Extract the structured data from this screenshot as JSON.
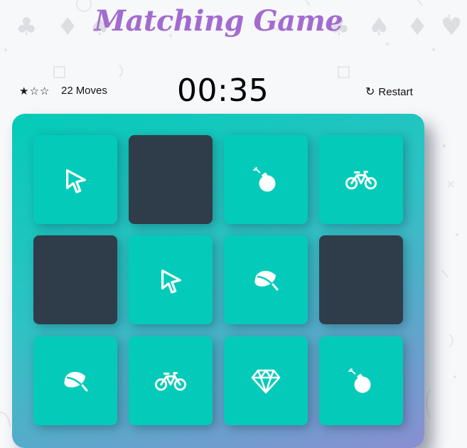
{
  "title": "Matching Game",
  "score_panel": {
    "stars_filled": 1,
    "stars_total": 3,
    "moves_count": "22",
    "moves_label": "Moves",
    "timer": "00:35",
    "restart_label": "Restart"
  },
  "colors": {
    "title": "#a36bd0",
    "card_open": "#04cbb9",
    "card_closed": "#2e3d49",
    "deck_gradient_start": "#04cbb8",
    "deck_gradient_end": "#8a8ed2"
  },
  "deck": [
    [
      {
        "state": "open",
        "icon": "mouse-pointer-icon"
      },
      {
        "state": "closed",
        "icon": ""
      },
      {
        "state": "open",
        "icon": "bomb-icon"
      },
      {
        "state": "open",
        "icon": "bicycle-icon"
      }
    ],
    [
      {
        "state": "closed",
        "icon": ""
      },
      {
        "state": "open",
        "icon": "mouse-pointer-icon"
      },
      {
        "state": "open",
        "icon": "leaf-icon"
      },
      {
        "state": "closed",
        "icon": ""
      }
    ],
    [
      {
        "state": "open",
        "icon": "leaf-icon"
      },
      {
        "state": "open",
        "icon": "bicycle-icon"
      },
      {
        "state": "open",
        "icon": "diamond-icon"
      },
      {
        "state": "open",
        "icon": "bomb-icon"
      }
    ]
  ]
}
